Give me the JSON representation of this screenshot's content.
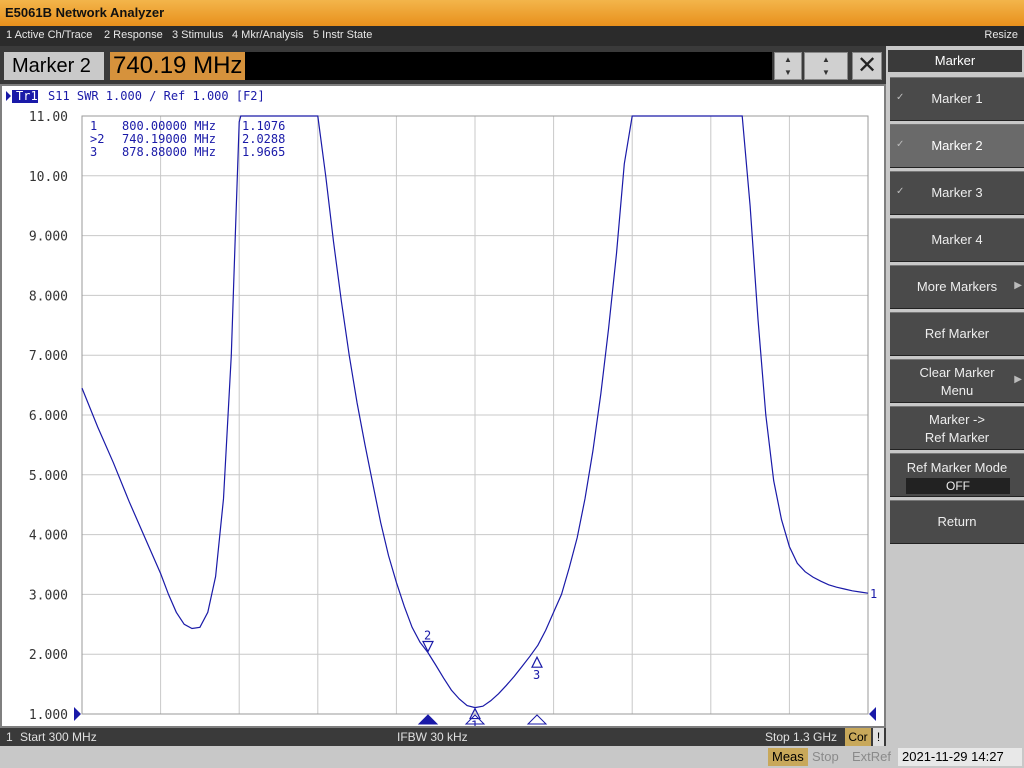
{
  "window": {
    "title": "E5061B Network Analyzer"
  },
  "menu": {
    "items": [
      "1 Active Ch/Trace",
      "2 Response",
      "3 Stimulus",
      "4 Mkr/Analysis",
      "5 Instr State"
    ],
    "resize_label": "Resize"
  },
  "entry": {
    "label": "Marker 2",
    "value": "740.19 MHz"
  },
  "trace_header": {
    "tag": "Tr1",
    "text": "S11  SWR 1.000 / Ref 1.000  [F2]"
  },
  "softkeys": {
    "header": "Marker",
    "items": [
      {
        "label": "Marker 1",
        "checked": true,
        "active": false
      },
      {
        "label": "Marker 2",
        "checked": true,
        "active": true
      },
      {
        "label": "Marker 3",
        "checked": true,
        "active": false
      },
      {
        "label": "Marker 4",
        "checked": false,
        "active": false
      },
      {
        "label": "More Markers",
        "submenu": true
      },
      {
        "label": "Ref Marker"
      },
      {
        "label": "Clear Marker",
        "label2": "Menu",
        "submenu": true
      },
      {
        "label": "Marker ->",
        "label2": "Ref Marker"
      },
      {
        "label": "Ref Marker Mode",
        "value": "OFF"
      },
      {
        "label": "Return"
      }
    ]
  },
  "status": {
    "channel": "1",
    "start": "Start 300 MHz",
    "ifbw": "IFBW 30 kHz",
    "stop": "Stop 1.3 GHz",
    "cor": "Cor",
    "flag": "!"
  },
  "bottom": {
    "meas": "Meas",
    "stop": "Stop",
    "extref": "ExtRef",
    "datetime": "2021-11-29 14:27"
  },
  "chart_data": {
    "type": "line",
    "x_unit": "MHz",
    "x_range": [
      300,
      1300
    ],
    "ylim": [
      1.0,
      11.0
    ],
    "y_ticks": [
      "11.00",
      "10.00",
      "9.000",
      "8.000",
      "7.000",
      "6.000",
      "5.000",
      "4.000",
      "3.000",
      "2.000",
      "1.000"
    ],
    "grid": true,
    "marker_table": [
      {
        "id": "1",
        "active": false,
        "freq": "800.00000 MHz",
        "value": "1.1076"
      },
      {
        "id": "2",
        "active": true,
        "freq": "740.19000 MHz",
        "value": "2.0288"
      },
      {
        "id": "3",
        "active": false,
        "freq": "878.88000 MHz",
        "value": "1.9665"
      }
    ],
    "markers": [
      {
        "id": "1",
        "x": 800.0,
        "y": 1.1076
      },
      {
        "id": "2",
        "x": 740.19,
        "y": 2.0288
      },
      {
        "id": "3",
        "x": 878.88,
        "y": 1.9665
      }
    ],
    "series": [
      {
        "color": "#1a1aa8",
        "x": [
          300,
          320,
          340,
          360,
          380,
          400,
          410,
          420,
          430,
          440,
          450,
          460,
          470,
          480,
          490,
          495,
          500,
          502,
          510,
          530,
          550,
          570,
          580,
          590,
          600,
          610,
          620,
          630,
          640,
          650,
          660,
          670,
          680,
          690,
          700,
          710,
          720,
          730,
          740,
          750,
          760,
          770,
          780,
          790,
          800,
          810,
          820,
          830,
          840,
          850,
          860,
          870,
          880,
          890,
          900,
          910,
          920,
          930,
          940,
          950,
          960,
          970,
          980,
          990,
          1000,
          1010,
          1020,
          1025,
          1030,
          1040,
          1080,
          1120,
          1130,
          1140,
          1150,
          1160,
          1170,
          1180,
          1190,
          1200,
          1210,
          1220,
          1230,
          1240,
          1250,
          1260,
          1270,
          1280,
          1290,
          1300
        ],
        "y": [
          6.45,
          5.8,
          5.2,
          4.55,
          3.95,
          3.35,
          3.0,
          2.7,
          2.5,
          2.43,
          2.45,
          2.7,
          3.3,
          4.6,
          7.0,
          9.0,
          10.9,
          11.0,
          11.0,
          11.0,
          11.0,
          11.0,
          11.0,
          11.0,
          11.0,
          10.0,
          8.9,
          7.9,
          7.0,
          6.2,
          5.5,
          4.85,
          4.2,
          3.65,
          3.2,
          2.8,
          2.45,
          2.2,
          2.03,
          1.82,
          1.6,
          1.4,
          1.25,
          1.14,
          1.1076,
          1.13,
          1.22,
          1.34,
          1.48,
          1.63,
          1.8,
          1.9665,
          2.15,
          2.4,
          2.7,
          3.0,
          3.45,
          3.95,
          4.6,
          5.4,
          6.35,
          7.45,
          8.7,
          10.2,
          11.0,
          11.0,
          11.0,
          11.0,
          11.0,
          11.0,
          11.0,
          11.0,
          11.0,
          11.0,
          9.5,
          7.6,
          6.0,
          4.9,
          4.25,
          3.8,
          3.52,
          3.38,
          3.29,
          3.22,
          3.16,
          3.12,
          3.09,
          3.06,
          3.04,
          3.02
        ]
      }
    ]
  }
}
